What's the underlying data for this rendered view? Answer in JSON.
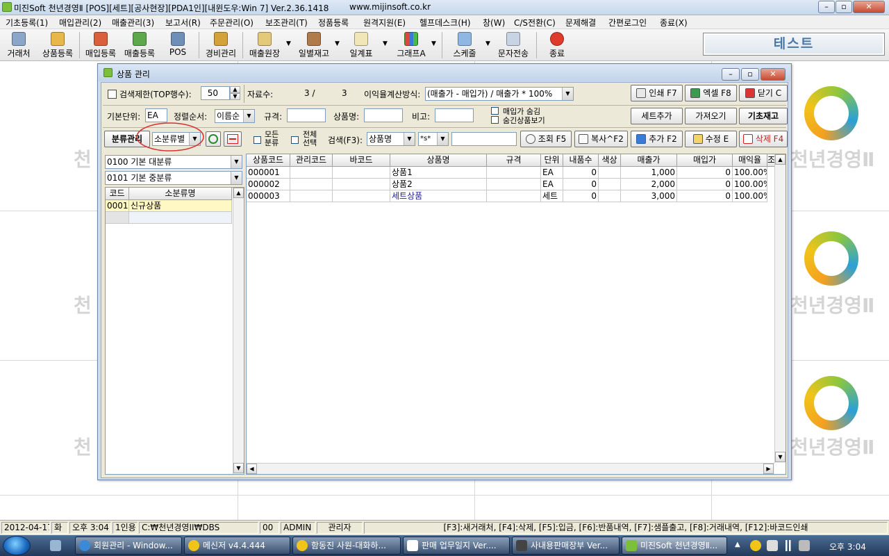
{
  "app": {
    "title": "미진Soft 천년경영Ⅱ [POS][세트][공사현장][PDA1인][내윈도우:Win 7] Ver.2.36.1418",
    "url": "www.mijinsoft.co.kr"
  },
  "menu": [
    "기초등록(1)",
    "매입관리(2)",
    "매출관리(3)",
    "보고서(R)",
    "주문관리(O)",
    "보조관리(T)",
    "정품등록",
    "원격지원(E)",
    "헬프데스크(H)",
    "창(W)",
    "C/S전환(C)",
    "문제해결",
    "간편로그인",
    "종료(X)"
  ],
  "toolbar": {
    "items": [
      "거래처",
      "상품등록",
      "매입등록",
      "매출등록",
      "POS",
      "경비관리",
      "매출원장",
      "일별재고",
      "일계표",
      "그래프A",
      "스케줄",
      "문자전송",
      "종료"
    ],
    "test_label": "테스트"
  },
  "watermark": "천년경영Ⅱ",
  "window": {
    "title": "상품 관리",
    "row1": {
      "search_limit_label": "검색제한(TOP행수):",
      "search_limit_value": "50",
      "count_label": "자료수:",
      "count_value": "3 /",
      "count_total": "3",
      "margin_label": "이익율계산방식:",
      "margin_value": "(매출가 - 매입가) / 매출가 * 100%",
      "print_btn": "인쇄 F7",
      "excel_btn": "엑셀 F8",
      "close_btn": "닫기 C"
    },
    "row2": {
      "unit_label": "기본단위:",
      "unit_value": "EA",
      "sort_label": "정렬순서:",
      "sort_value": "이름순",
      "spec_label": "규격:",
      "name_label": "상품명:",
      "note_label": "비고:",
      "hide_cost": "매입가 숨김",
      "show_hidden": "숨긴상품보기",
      "set_add_btn": "세트추가",
      "import_btn": "가져오기",
      "base_stock_btn": "기초재고"
    },
    "row3": {
      "category_btn": "분류관리",
      "category_select": "소분류별",
      "all_category_1": "모든",
      "all_category_2": "분류",
      "select_all_1": "전체",
      "select_all_2": "선택",
      "search_label": "검색(F3):",
      "search_field": "상품명",
      "search_mode": "*s*",
      "query_btn": "조회 F5",
      "copy_btn": "복사^F2",
      "add_btn": "추가 F2",
      "edit_btn": "수정 E",
      "delete_btn": "삭제 F4"
    },
    "left": {
      "major": "0100 기본 대분류",
      "middle": "0101 기본 중분류",
      "headers": [
        "코드",
        "소분류명"
      ],
      "rows": [
        {
          "code": "0001",
          "name": "신규상품"
        }
      ]
    },
    "grid": {
      "headers": [
        "상품코드",
        "관리코드",
        "바코드",
        "상품명",
        "규격",
        "단위",
        "내품수",
        "색상",
        "매출가",
        "매입가",
        "매익율",
        "조"
      ],
      "rows": [
        {
          "code": "000001",
          "mgmt": "",
          "barcode": "",
          "name": "상품1",
          "spec": "",
          "unit": "EA",
          "qty": "0",
          "color": "",
          "sale": "1,000",
          "cost": "0",
          "rate": "100.00%"
        },
        {
          "code": "000002",
          "mgmt": "",
          "barcode": "",
          "name": "상품2",
          "spec": "",
          "unit": "EA",
          "qty": "0",
          "color": "",
          "sale": "2,000",
          "cost": "0",
          "rate": "100.00%"
        },
        {
          "code": "000003",
          "mgmt": "",
          "barcode": "",
          "name": "세트상품",
          "spec": "",
          "unit": "세트",
          "qty": "0",
          "color": "",
          "sale": "3,000",
          "cost": "0",
          "rate": "100.00%"
        }
      ]
    }
  },
  "status": {
    "date": "2012-04-17",
    "weekday": "화",
    "time": "오후 3:04",
    "users": "1인용",
    "path": "C:₩천년경영II₩DBS",
    "code": "00",
    "user": "ADMIN",
    "role": "관리자",
    "hint": "[F3]:새거래처, [F4]:삭제, [F5]:입금, [F6]:반품내역, [F7]:샘플출고, [F8]:거래내역, [F12]:바코드인쇄"
  },
  "taskbar": {
    "tasks": [
      "회원관리 - Window...",
      "메신저 v4.4.444",
      "함동진 사원-대화하...",
      "판매 업무일지 Ver....",
      "사내용판매장부 Ver...",
      "미진Soft 천년경영Ⅱ..."
    ],
    "clock": "오후 3:04"
  }
}
